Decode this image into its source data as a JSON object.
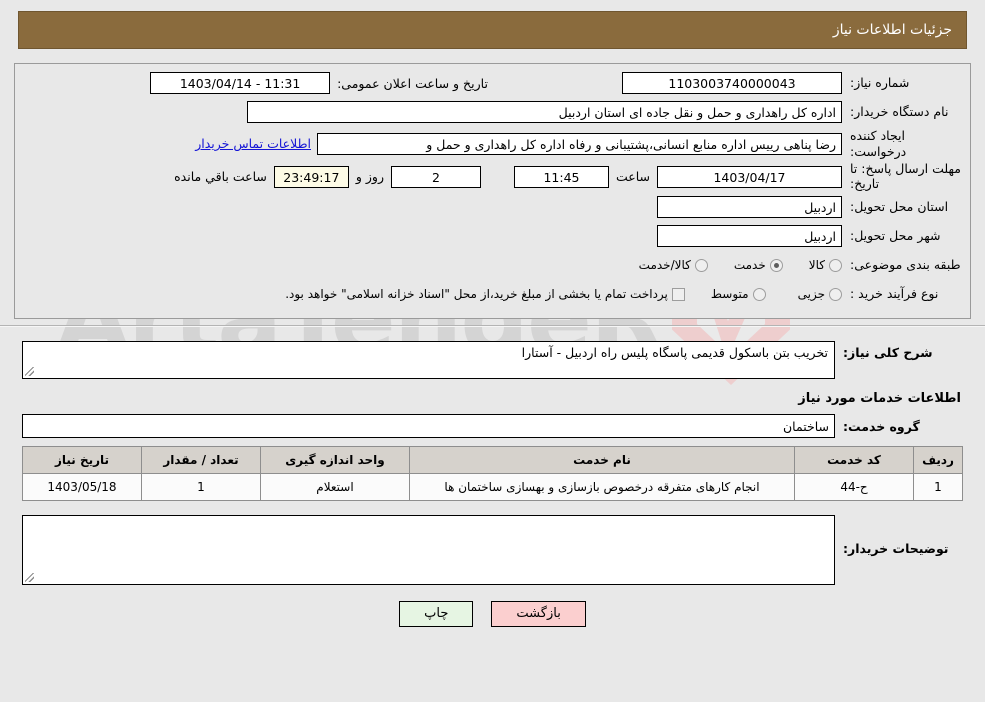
{
  "header": {
    "title": "جزئیات اطلاعات نیاز",
    "bg_color": "#8a6b3d"
  },
  "watermark": {
    "text": "ArtaTendeR",
    "shield_color": "#f0c4c4",
    "text_color": "#c9c9c9"
  },
  "form": {
    "need_number": {
      "label": "شماره نیاز:",
      "value": "1103003740000043"
    },
    "public_announce": {
      "label": "تاریخ و ساعت اعلان عمومی:",
      "value": "1403/04/14 - 11:31"
    },
    "buyer_org": {
      "label": "نام دستگاه خریدار:",
      "value": "اداره کل راهداری و حمل و نقل جاده ای استان اردبیل"
    },
    "requester": {
      "label": "ایجاد کننده درخواست:",
      "value": "رضا پناهی رییس اداره منابع انسانی،پشتیبانی و رفاه اداره کل راهداری و حمل و",
      "link": "اطلاعات تماس خریدار"
    },
    "deadline": {
      "label": "مهلت ارسال پاسخ: تا تاریخ:",
      "date": "1403/04/17",
      "time_label": "ساعت",
      "time": "11:45",
      "days": "2",
      "days_label": "روز و",
      "countdown": "23:49:17",
      "remaining_label": "ساعت باقي مانده"
    },
    "province": {
      "label": "استان محل تحویل:",
      "value": "اردبیل"
    },
    "city": {
      "label": "شهر محل تحویل:",
      "value": "اردبیل"
    },
    "category": {
      "label": "طبقه بندی موضوعی:",
      "options": [
        {
          "text": "کالا",
          "selected": false
        },
        {
          "text": "خدمت",
          "selected": true
        },
        {
          "text": "کالا/خدمت",
          "selected": false
        }
      ]
    },
    "purchase_type": {
      "label": "نوع فرآیند خرید :",
      "options": [
        {
          "text": "جزیی",
          "selected": false
        },
        {
          "text": "متوسط",
          "selected": false
        }
      ]
    },
    "treasury_note": {
      "checked": false,
      "text": "پرداخت تمام یا بخشی از مبلغ خرید،از محل \"اسناد خزانه اسلامی\" خواهد بود."
    }
  },
  "details": {
    "general_desc": {
      "label": "شرح کلی نیاز:",
      "value": "تخریب بتن باسکول قدیمی پاسگاه پلیس راه اردبیل - آستارا"
    },
    "services_heading": "اطلاعات خدمات مورد نیاز",
    "service_group": {
      "label": "گروه خدمت:",
      "value": "ساختمان"
    },
    "table": {
      "columns": [
        "ردیف",
        "کد خدمت",
        "نام خدمت",
        "واحد اندازه گیری",
        "تعداد / مقدار",
        "تاریخ نیاز"
      ],
      "rows": [
        {
          "row_no": "1",
          "service_code": "ح-44",
          "service_name": "انجام کارهای متفرقه درخصوص بازسازی و بهسازی ساختمان ها",
          "unit": "استعلام",
          "quantity": "1",
          "need_date": "1403/05/18"
        }
      ]
    },
    "buyer_notes": {
      "label": "توضیحات خریدار:",
      "value": ""
    }
  },
  "buttons": {
    "print": {
      "label": "چاپ",
      "color": "#e6f5e3"
    },
    "back": {
      "label": "بازگشت",
      "color": "#fbcfcf"
    }
  }
}
